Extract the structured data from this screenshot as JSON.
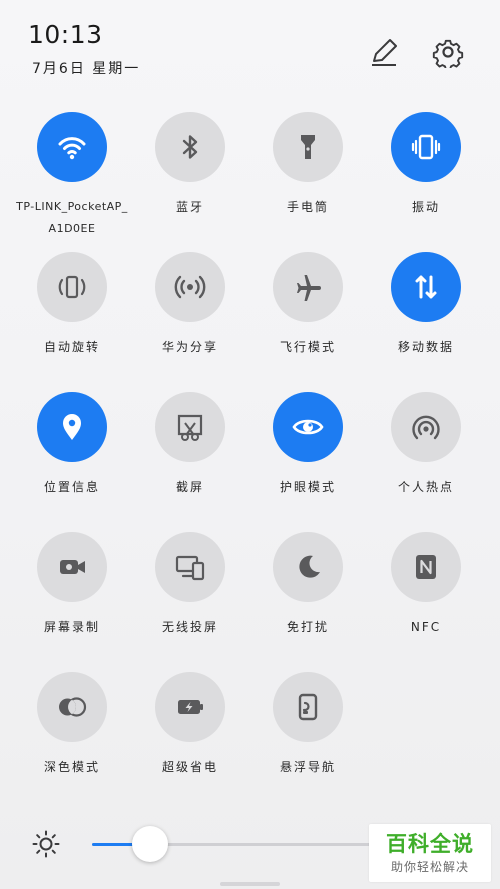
{
  "status": {
    "time": "10:13",
    "date": "7月6日 星期一"
  },
  "header": {
    "edit_icon": "edit-pencil-icon",
    "settings_icon": "gear-icon"
  },
  "colors": {
    "accent_on": "#1d7cf2",
    "tile_off": "#dcdcde",
    "icon_off": "#5a5a5c",
    "icon_on": "#ffffff"
  },
  "tiles": [
    {
      "label": "TP-LINK_PocketAP_A1D0EE",
      "icon": "wifi-icon",
      "active": true
    },
    {
      "label": "蓝牙",
      "icon": "bluetooth-icon",
      "active": false
    },
    {
      "label": "手电筒",
      "icon": "flashlight-icon",
      "active": false
    },
    {
      "label": "振动",
      "icon": "vibrate-icon",
      "active": true
    },
    {
      "label": "自动旋转",
      "icon": "auto-rotate-icon",
      "active": false
    },
    {
      "label": "华为分享",
      "icon": "huawei-share-icon",
      "active": false
    },
    {
      "label": "飞行模式",
      "icon": "airplane-icon",
      "active": false
    },
    {
      "label": "移动数据",
      "icon": "mobile-data-icon",
      "active": true
    },
    {
      "label": "位置信息",
      "icon": "location-icon",
      "active": true
    },
    {
      "label": "截屏",
      "icon": "screenshot-icon",
      "active": false
    },
    {
      "label": "护眼模式",
      "icon": "eye-icon",
      "active": true
    },
    {
      "label": "个人热点",
      "icon": "hotspot-icon",
      "active": false
    },
    {
      "label": "屏幕录制",
      "icon": "screen-record-icon",
      "active": false
    },
    {
      "label": "无线投屏",
      "icon": "wireless-projection-icon",
      "active": false
    },
    {
      "label": "免打扰",
      "icon": "moon-icon",
      "active": false
    },
    {
      "label": "NFC",
      "icon": "nfc-icon",
      "active": false
    },
    {
      "label": "深色模式",
      "icon": "dark-mode-icon",
      "active": false
    },
    {
      "label": "超级省电",
      "icon": "battery-saver-icon",
      "active": false
    },
    {
      "label": "悬浮导航",
      "icon": "floating-nav-icon",
      "active": false
    }
  ],
  "brightness": {
    "icon": "sun-icon",
    "level": 0.2
  },
  "watermark": {
    "title": "百科全说",
    "subtitle": "助你轻松解决"
  }
}
